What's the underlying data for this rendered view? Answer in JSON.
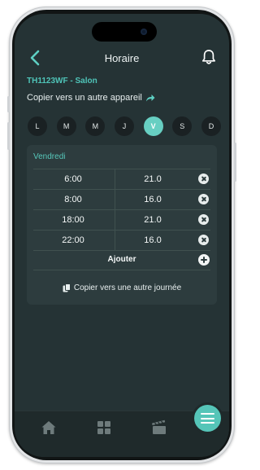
{
  "header": {
    "title": "Horaire",
    "back_icon": "chevron-left-icon",
    "notification_icon": "bell-icon"
  },
  "device": {
    "name": "TH1123WF - Salon",
    "copy_label": "Copier vers un autre appareil",
    "copy_icon": "share-arrow-icon"
  },
  "days": [
    {
      "label": "L",
      "active": false
    },
    {
      "label": "M",
      "active": false
    },
    {
      "label": "M",
      "active": false
    },
    {
      "label": "J",
      "active": false
    },
    {
      "label": "V",
      "active": true
    },
    {
      "label": "S",
      "active": false
    },
    {
      "label": "D",
      "active": false
    }
  ],
  "schedule": {
    "day_title": "Vendredi",
    "rows": [
      {
        "time": "6:00",
        "temp": "21.0"
      },
      {
        "time": "8:00",
        "temp": "16.0"
      },
      {
        "time": "18:00",
        "temp": "21.0"
      },
      {
        "time": "22:00",
        "temp": "16.0"
      }
    ],
    "add_label": "Ajouter",
    "copy_day_label": "Copier vers une autre journée"
  },
  "tabbar": {
    "items": [
      "home-icon",
      "grid-icon",
      "clapperboard-icon"
    ],
    "menu_icon": "hamburger-menu-icon"
  },
  "colors": {
    "accent": "#55c5b8",
    "background": "#253335",
    "card": "#2d3c3e"
  }
}
